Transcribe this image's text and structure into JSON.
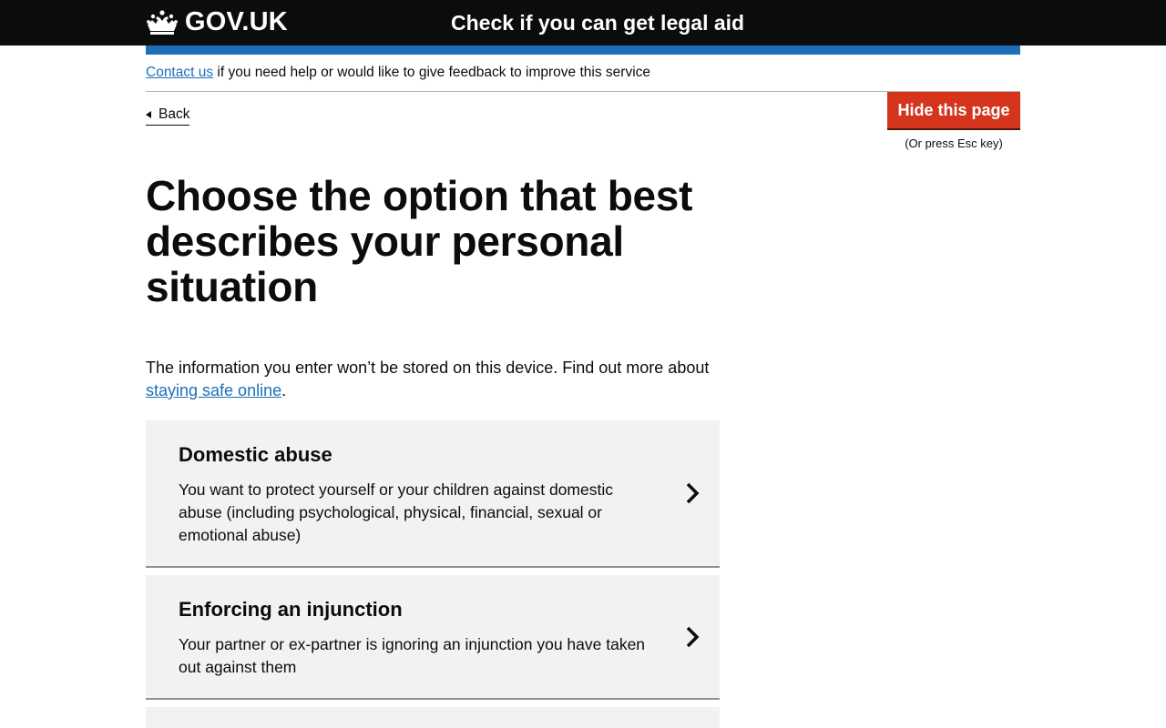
{
  "header": {
    "logo_text": "GOV.UK",
    "service_name": "Check if you can get legal aid"
  },
  "feedback": {
    "link_text": "Contact us",
    "rest_text": " if you need help or would like to give feedback to improve this service"
  },
  "nav": {
    "back_label": "Back"
  },
  "hide_page": {
    "button_label": "Hide this page",
    "hint": "(Or press Esc key)"
  },
  "main": {
    "title": "Choose the option that best describes your personal situation",
    "intro_text": "The information you enter won’t be stored on this device. Find out more about ",
    "intro_link": "staying safe online",
    "intro_end": "."
  },
  "options": [
    {
      "title": "Domestic abuse",
      "description": "You want to protect yourself or your children against domestic abuse (including psychological, physical, financial, sexual or emotional abuse)"
    },
    {
      "title": "Enforcing an injunction",
      "description": "Your partner or ex-partner is ignoring an injunction you have taken out against them"
    }
  ],
  "icons": {
    "crown": "crown-icon",
    "chevron": "chevron-right-icon"
  },
  "colors": {
    "header_bg": "#0b0c0c",
    "brand_blue": "#1d70b8",
    "hide_red": "#d4351c",
    "card_bg": "#f3f2f1"
  }
}
